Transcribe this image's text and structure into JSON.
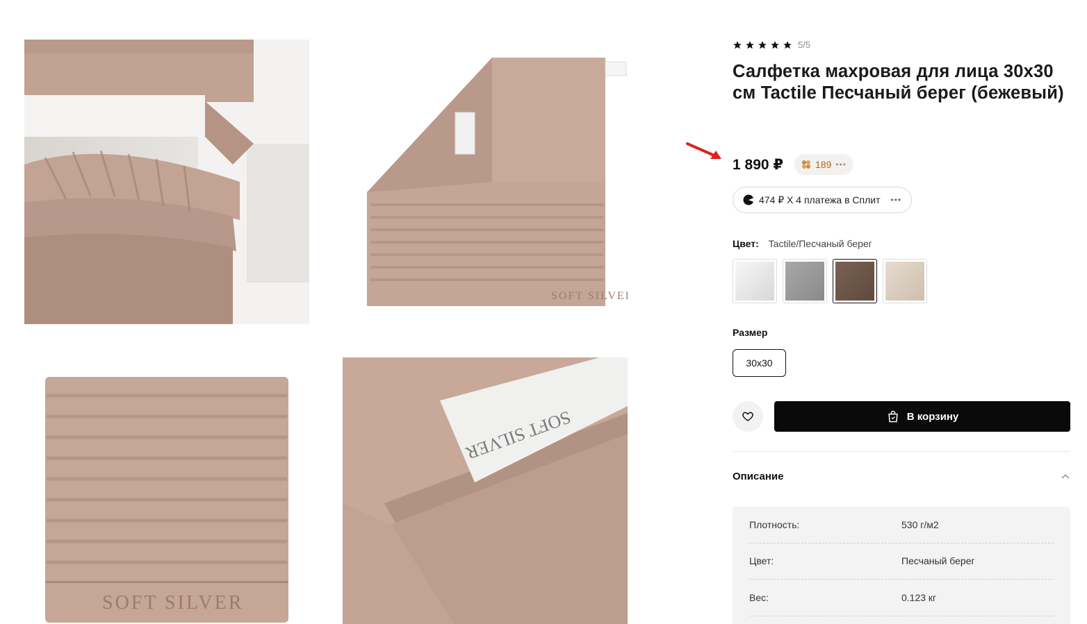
{
  "product": {
    "rating_text": "5/5",
    "stars": 5,
    "title": "Салфетка махровая для лица 30х30 см Tactile Песчаный берег (бежевый)",
    "price": "1 890 ₽",
    "bonus": "189",
    "split": "474 ₽ Х 4 платежа в Сплит",
    "color_label": "Цвет:",
    "color_value": "Tactile/Песчаный берег",
    "swatches": [
      {
        "name": "white",
        "color": "#e9e9e9"
      },
      {
        "name": "grey",
        "color": "#9a9a9a"
      },
      {
        "name": "brown",
        "color": "#6f584a"
      },
      {
        "name": "sand",
        "color": "#d9cdbd"
      }
    ],
    "selected_swatch": 2,
    "size_label": "Размер",
    "size_option": "30x30",
    "cart_label": "В корзину",
    "description_label": "Описание",
    "specs": [
      {
        "key": "Плотность:",
        "value": "530 г/м2"
      },
      {
        "key": "Цвет:",
        "value": "Песчаный берег"
      },
      {
        "key": "Вес:",
        "value": "0.123 кг"
      }
    ]
  },
  "images": {
    "label_text": "SOFT SILVER",
    "tag_text": "SOFT SILVER"
  },
  "colors": {
    "towel": "#c4a494",
    "towel_dark": "#a88878",
    "annotation_arrow": "#e0201c",
    "bonus_text": "#b5651d"
  }
}
